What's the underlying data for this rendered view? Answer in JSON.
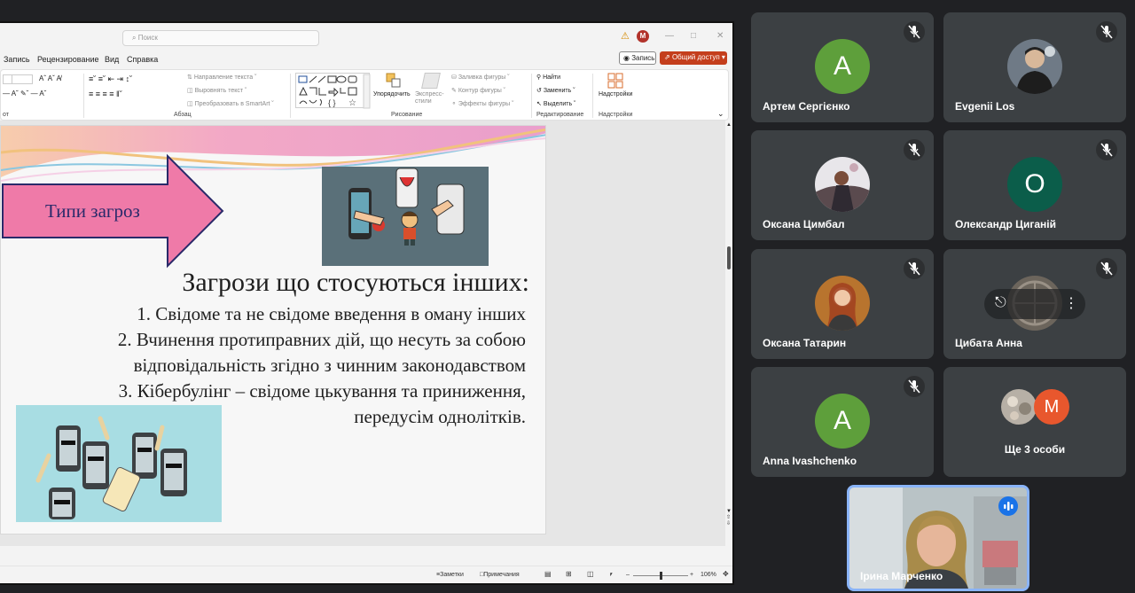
{
  "ppt": {
    "search_placeholder": "Поиск",
    "user_initial": "M",
    "menu": [
      "Запись",
      "Рецензирование",
      "Вид",
      "Справка"
    ],
    "record_button": "Запись",
    "share_button": "Общий доступ",
    "ribbon": {
      "group_labels": [
        "от",
        "Абзац",
        "Рисование",
        "Редактирование",
        "Надстройки"
      ],
      "paragraph_items": [
        "Направление текста",
        "Выровнять текст",
        "Преобразовать в SmartArt"
      ],
      "arrange_label": "Упорядочить",
      "express_label": "Экспресс-стили",
      "drawing_items": [
        "Заливка фигуры",
        "Контур фигуры",
        "Эффекты фигуры"
      ],
      "editing_items": [
        "Найти",
        "Заменить",
        "Выделить"
      ],
      "addins_label": "Надстройки"
    },
    "slide": {
      "arrow_text": "Типи загроз",
      "title": "Загрози що стосуються інших:",
      "lines": [
        "1. Свідоме та не свідоме введення в оману інших",
        "2. Вчинення протиправних дій, що несуть за собою",
        "відповідальність згідно з чинним законодавством",
        "3. Кібербулінг – свідоме цькування та приниження,",
        "передусім однолітків."
      ]
    },
    "status": {
      "notes": "Заметки",
      "comments": "Примечания",
      "zoom": "106%"
    }
  },
  "participants": [
    {
      "name": "Артем Сергієнко",
      "avatar": "letter",
      "initial": "А",
      "color": "#5e9f3b",
      "muted": true
    },
    {
      "name": "Evgenii Los",
      "avatar": "photo",
      "muted": true
    },
    {
      "name": "Оксана Цимбал",
      "avatar": "photo",
      "muted": true
    },
    {
      "name": "Олександр Циганій",
      "avatar": "letter",
      "initial": "О",
      "color": "#0b5d4a",
      "muted": true
    },
    {
      "name": "Оксана Татарин",
      "avatar": "photo",
      "muted": true
    },
    {
      "name": "Цибата Анна",
      "avatar": "photo",
      "muted": true
    },
    {
      "name": "Anna Ivashchenko",
      "avatar": "letter",
      "initial": "А",
      "color": "#5e9f3b",
      "muted": true
    },
    {
      "name": "Ще 3 особи",
      "avatar": "group",
      "initial": "M",
      "color": "#e8572d"
    }
  ],
  "self": {
    "name": "Ірина Марченко",
    "speaking": true
  }
}
